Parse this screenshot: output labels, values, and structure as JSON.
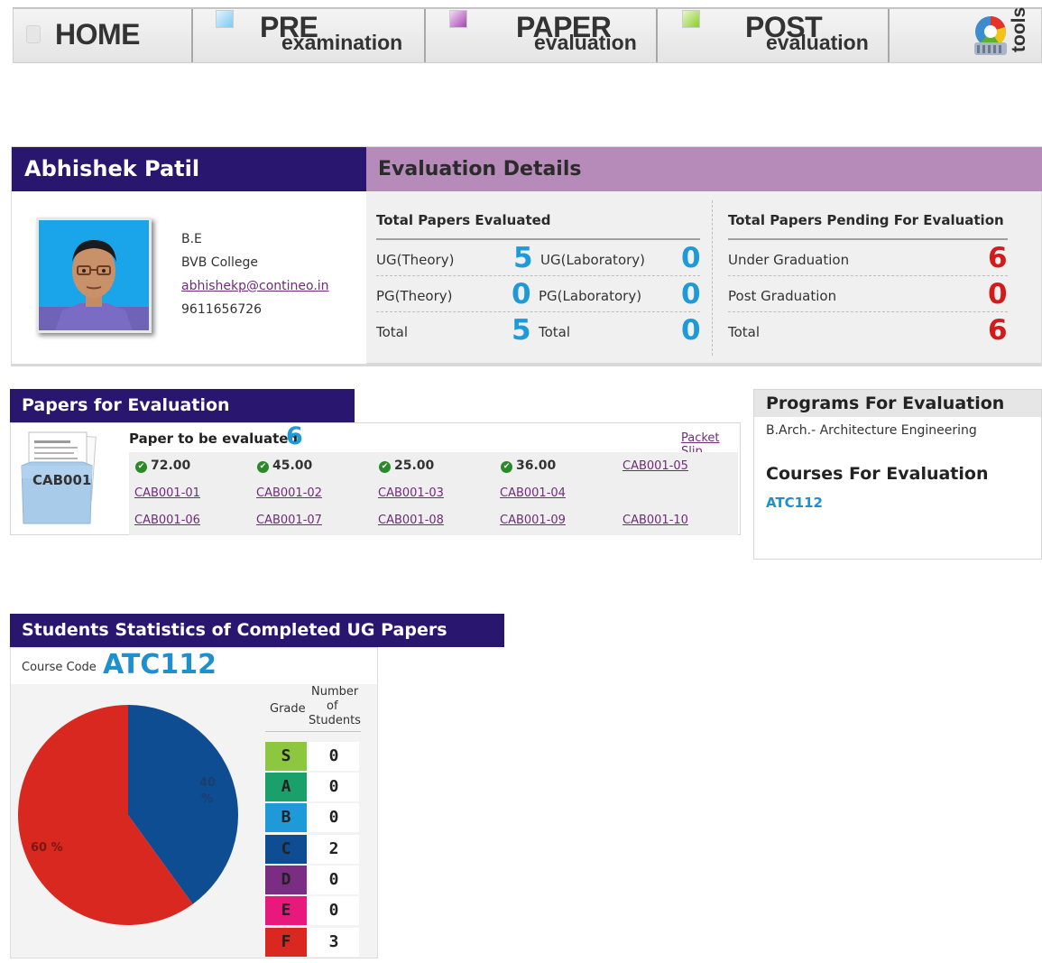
{
  "nav": {
    "home": "HOME",
    "pre_big": "PRE",
    "pre_small": "examination",
    "paper_big": "PAPER",
    "paper_small": "evaluation",
    "post_big": "POST",
    "post_small": "evaluation",
    "tools": "tools"
  },
  "profile": {
    "name": "Abhishek Patil",
    "degree": "B.E",
    "college": "BVB College",
    "email": "abhishekp@contineo.in",
    "phone": "9611656726"
  },
  "evaluation": {
    "title": "Evaluation Details",
    "evaluated_head": "Total Papers Evaluated",
    "ug_theory_label": "UG(Theory)",
    "ug_theory": "5",
    "ug_lab_label": "UG(Laboratory)",
    "ug_lab": "0",
    "pg_theory_label": "PG(Theory)",
    "pg_theory": "0",
    "pg_lab_label": "PG(Laboratory)",
    "pg_lab": "0",
    "total_label": "Total",
    "total_theory": "5",
    "total_lab": "0",
    "pending_head": "Total Papers Pending For Evaluation",
    "under_grad_label": "Under Graduation",
    "under_grad": "6",
    "post_grad_label": "Post Graduation",
    "post_grad": "0",
    "pending_total_label": "Total",
    "pending_total": "6"
  },
  "papers": {
    "title": "Papers for Evaluation",
    "packet_code": "CAB001",
    "to_evaluate_label": "Paper to be evaluated",
    "to_evaluate_count": "6",
    "packet_slip": "Packet Slip",
    "scores": [
      "72.00",
      "45.00",
      "25.00",
      "36.00"
    ],
    "links_row1": [
      "CAB001-05"
    ],
    "links_row2": [
      "CAB001-01",
      "CAB001-02",
      "CAB001-03",
      "CAB001-04"
    ],
    "links_row3": [
      "CAB001-06",
      "CAB001-07",
      "CAB001-08",
      "CAB001-09",
      "CAB001-10"
    ]
  },
  "programs": {
    "title": "Programs For Evaluation",
    "program": "B.Arch.- Architecture Engineering",
    "courses_title": "Courses For Evaluation",
    "course": "ATC112"
  },
  "stats": {
    "title": "Students Statistics of Completed UG Papers",
    "course_code_label": "Course Code",
    "course_code": "ATC112",
    "grade_header": "Grade",
    "count_header_1": "Number",
    "count_header_2": "of",
    "count_header_3": "Students",
    "pie_label_40": "40",
    "pie_label_40_pct": "%",
    "pie_label_60": "60 %",
    "grades": [
      {
        "grade": "S",
        "count": "0",
        "color": "#8dc63f"
      },
      {
        "grade": "A",
        "count": "0",
        "color": "#1aa06b"
      },
      {
        "grade": "B",
        "count": "0",
        "color": "#1e9ad8"
      },
      {
        "grade": "C",
        "count": "2",
        "color": "#0f4d93"
      },
      {
        "grade": "D",
        "count": "0",
        "color": "#7a2d82"
      },
      {
        "grade": "E",
        "count": "0",
        "color": "#e8197d"
      },
      {
        "grade": "F",
        "count": "3",
        "color": "#d8281f"
      }
    ]
  },
  "chart_data": {
    "type": "pie",
    "categories": [
      "C",
      "F"
    ],
    "values": [
      40,
      60
    ],
    "colors": [
      "#0f4d93",
      "#d8281f"
    ]
  },
  "colors": {
    "header_navy": "#28166f",
    "header_purple": "#b68ab9",
    "accent_blue": "#1e9ad8",
    "accent_red": "#d41b1b",
    "link_purple": "#6f2c79"
  }
}
